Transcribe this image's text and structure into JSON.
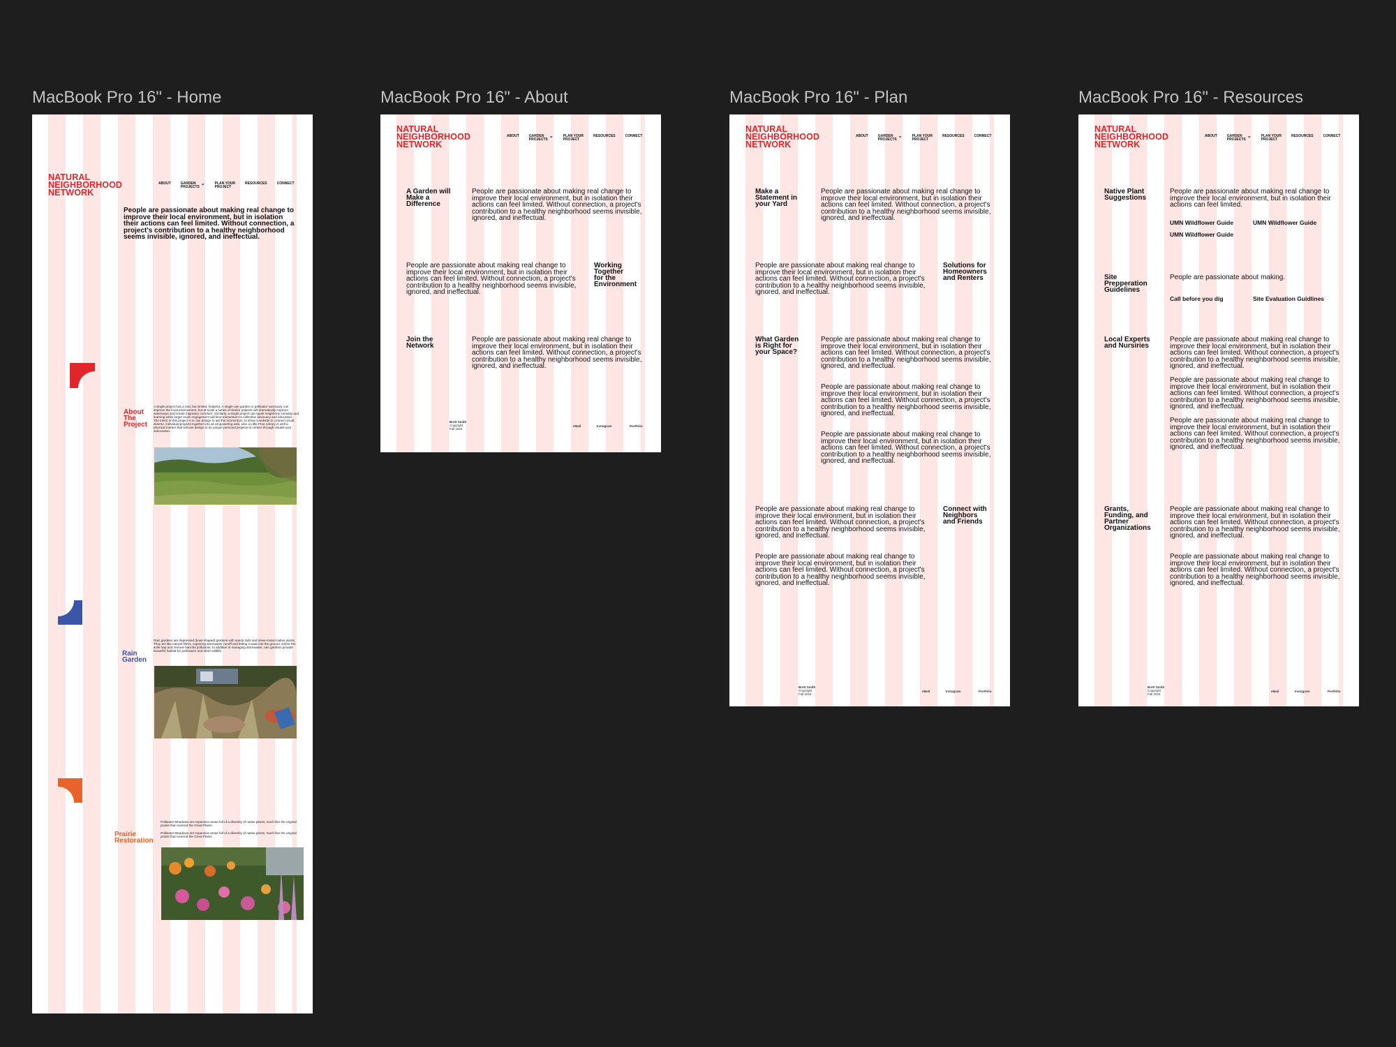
{
  "frames": {
    "home": {
      "title": "MacBook Pro 16\" - Home"
    },
    "about": {
      "title": "MacBook Pro 16\" - About"
    },
    "plan": {
      "title": "MacBook Pro 16\" - Plan"
    },
    "resources": {
      "title": "MacBook Pro 16\" - Resources"
    }
  },
  "site": {
    "logo": [
      "NATURAL",
      "NEIGHBORHOOD",
      "NETWORK"
    ],
    "nav": {
      "about": "ABOUT",
      "garden_projects": [
        "GARDEN",
        "PROJECTS"
      ],
      "plan": [
        "PLAN YOUR",
        "PROJECT"
      ],
      "resources": "RESOURCES",
      "connect": "CONNECT"
    },
    "footer": {
      "name": "Brett Smith",
      "copyright": "Copyright",
      "term": "Fall 2024",
      "email": "eMail",
      "instagram": "Instagram",
      "portfolio": "Portfolio"
    },
    "accent": "#e0262a",
    "column_tint": "#fde6e4"
  },
  "home": {
    "intro": "People are passionate about making real change to improve their local environment, but in isolation their actions can feel limited. Without connection, a project's contribution to a healthy neighborhood seems invisible, ignored, and ineffectual.",
    "sections": [
      {
        "heading": [
          "About",
          "The",
          "Project"
        ],
        "color": "#e0262a",
        "text": "A single project has a real, but limited, footprint. A single rain garden or pollinator sanctuary can improve the local environment, but at scale a series of similar projects will dramatically improve waterways and create migratory corridors. Similarly, a single project can spark neighborly curiosity and learning while larger scale engagement will lend momentum to collective advocacy and education. The intent of this project is to use design to aid this momentum, to show a website to connect small, diverse, individual projects together into an empowering web. Like a Little Free Library is well a physical marker that will use design to do unique personal projects to cohere through visuals and association."
      },
      {
        "heading": [
          "Rain",
          "Garden"
        ],
        "color": "#3b55a8",
        "text": "Rain gardens are depressed (bowl-shaped) gardens with sandy soils and deep-rooted native plants. They act like natural filters, capturing stormwater runoff and letting it soak into the ground, where the soils trap and remove harmful pollutants. In addition to managing stormwater, rain gardens provide beautiful habitat for pollinators and other wildlife."
      },
      {
        "heading": [
          "Prairie",
          "Restoration"
        ],
        "color": "#e8632a",
        "text": "Pollinator Meadows are expansive areas full of a diversity of native plants, much like the original prairie that covered the Great Plains.",
        "text2": "Pollinator Meadows are expansive areas full of a diversity of native plants, much like the original prairie that covered the Great Plains."
      }
    ]
  },
  "about": {
    "blocks": [
      {
        "heading": [
          "A Garden will",
          "Make a",
          "Difference"
        ],
        "text": "People are passionate about making real change to improve their local environment, but in isolation their actions can feel limited. Without connection, a project's contribution to a healthy neighborhood seems invisible, ignored, and ineffectual."
      },
      {
        "heading": [
          "Working",
          "Together",
          "for the",
          "Environment"
        ],
        "text": "People are passionate about making real change to improve their local environment, but in isolation their actions can feel limited. Without connection, a project's contribution to a healthy neighborhood seems invisible, ignored, and ineffectual."
      },
      {
        "heading": [
          "Join the",
          "Network"
        ],
        "text": "People are passionate about making real change to improve their local environment, but in isolation their actions can feel limited. Without connection, a project's contribution to a healthy neighborhood seems invisible, ignored, and ineffectual."
      }
    ]
  },
  "plan": {
    "blocks": [
      {
        "heading": [
          "Make a",
          "Statement in",
          "your Yard"
        ],
        "text": "People are passionate about making real change to improve their local environment, but in isolation their actions can feel limited. Without connection, a project's contribution to a healthy neighborhood seems invisible, ignored, and ineffectual."
      },
      {
        "heading": [
          "Solutions for",
          "Homeowners",
          "and Renters"
        ],
        "text": "People are passionate about making real change to improve their local environment, but in isolation their actions can feel limited. Without connection, a project's contribution to a healthy neighborhood seems invisible, ignored, and ineffectual."
      },
      {
        "heading": [
          "What Garden",
          "is Right for",
          "your Space?"
        ],
        "text": "People are passionate about making real change to improve their local environment, but in isolation their actions can feel limited. Without connection, a project's contribution to a healthy neighborhood seems invisible, ignored, and ineffectual."
      },
      {
        "heading": [
          "Connect with",
          "Neighbors",
          "and Friends"
        ],
        "text": "People are passionate about making real change to improve their local environment, but in isolation their actions can feel limited. Without connection, a project's contribution to a healthy neighborhood seems invisible, ignored, and ineffectual."
      }
    ]
  },
  "resources": {
    "native": {
      "heading": [
        "Native Plant",
        "Suggestions"
      ],
      "text": "People are passionate about making real change to improve their local environment, but in isolation their actions can feel limited.",
      "links": [
        "UMN Wildflower Guide",
        "UMN Wildflower Guide",
        "UMN Wildflower Guide"
      ]
    },
    "site": {
      "heading": [
        "Site",
        "Prepperation",
        "Guidelines"
      ],
      "text": "People are passionate about making.",
      "links": [
        "Call before you dig",
        "Site Evaluation Guidlines"
      ]
    },
    "experts": {
      "heading": [
        "Local Experts",
        "and Nursiries"
      ],
      "text": "People are passionate about making real change to improve their local environment, but in isolation their actions can feel limited. Without connection, a project's contribution to a healthy neighborhood seems invisible, ignored, and ineffectual."
    },
    "grants": {
      "heading": [
        "Grants,",
        "Funding, and",
        "Partner",
        "Organizations"
      ],
      "text": "People are passionate about making real change to improve their local environment, but in isolation their actions can feel limited. Without connection, a project's contribution to a healthy neighborhood seems invisible, ignored, and ineffectual."
    }
  }
}
